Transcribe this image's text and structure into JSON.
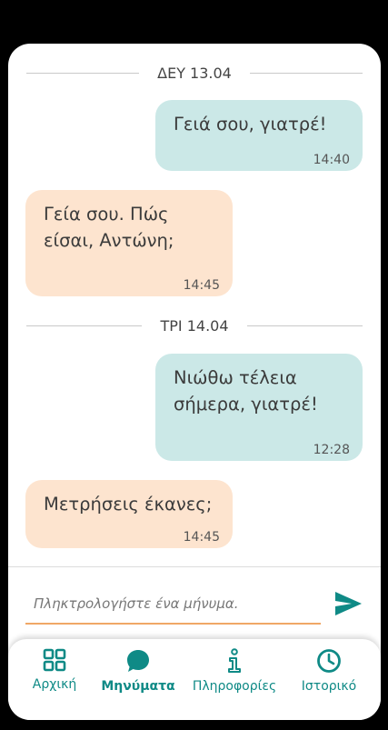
{
  "chat": {
    "days": [
      {
        "date": "ΔΕΥ 13.04",
        "messages": [
          {
            "side": "sent",
            "text": "Γειά σου, γιατρέ!",
            "time": "14:40"
          },
          {
            "side": "received",
            "text": "Γεία σου. Πώς είσαι, Αντώνη;",
            "time": "14:45"
          }
        ]
      },
      {
        "date": "ΤΡΙ 14.04",
        "messages": [
          {
            "side": "sent",
            "text": "Νιώθω τέλεια σήμερα, γιατρέ!",
            "time": "12:28"
          },
          {
            "side": "received",
            "text": "Μετρήσεις έκανες;",
            "time": "14:45"
          }
        ]
      }
    ]
  },
  "composer": {
    "placeholder": "Πληκτρολογήστε ένα μήνυμα.",
    "send_icon": "send-icon"
  },
  "nav": {
    "items": [
      {
        "label": "Αρχική",
        "icon": "grid-icon",
        "active": false
      },
      {
        "label": "Μηνύματα",
        "icon": "chat-bubble-icon",
        "active": true
      },
      {
        "label": "Πληροφορίες",
        "icon": "info-icon",
        "active": false
      },
      {
        "label": "Ιστορικό",
        "icon": "clock-icon",
        "active": false
      }
    ]
  },
  "colors": {
    "accent": "#0f8a86",
    "sent_bubble": "#cbe8e7",
    "received_bubble": "#fde4cf",
    "input_underline": "#f0a766"
  }
}
